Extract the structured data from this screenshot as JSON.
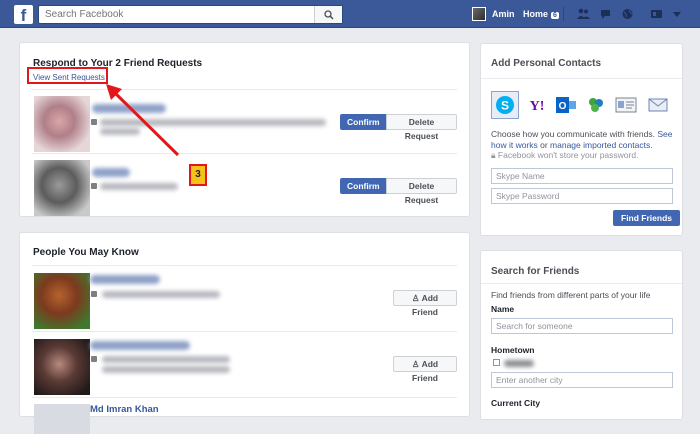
{
  "topbar": {
    "logo_letter": "f",
    "search_placeholder": "Search Facebook",
    "user_name": "Amin",
    "home_label": "Home",
    "home_badge": "6"
  },
  "friend_requests": {
    "title": "Respond to Your 2 Friend Requests",
    "sent_link": "View Sent Requests",
    "confirm_label": "Confirm",
    "delete_label": "Delete Request",
    "annotation_number": "3"
  },
  "people": {
    "title": "People You May Know",
    "add_friend_label": "Add Friend",
    "visible_name": "Md Imran Khan"
  },
  "contacts": {
    "title": "Add Personal Contacts",
    "services": [
      "skype-icon",
      "yahoo-icon",
      "outlook-icon",
      "windows-live-icon",
      "contacts-file-icon",
      "email-icon"
    ],
    "desc_before": "Choose how you communicate with friends. ",
    "desc_link1": "See how it works",
    "desc_mid": " or ",
    "desc_link2": "manage imported contacts",
    "desc_after": ".",
    "privacy_note": "Facebook won't store your password.",
    "skype_name_placeholder": "Skype Name",
    "skype_password_placeholder": "Skype Password",
    "find_friends_label": "Find Friends"
  },
  "search_friends": {
    "title": "Search for Friends",
    "desc": "Find friends from different parts of your life",
    "name_label": "Name",
    "name_placeholder": "Search for someone",
    "hometown_label": "Hometown",
    "hometown_placeholder": "Enter another city",
    "current_city_label": "Current City"
  },
  "colors": {
    "brand": "#3b5998",
    "button_blue": "#4267b2",
    "annotation_red": "#e3161b"
  }
}
